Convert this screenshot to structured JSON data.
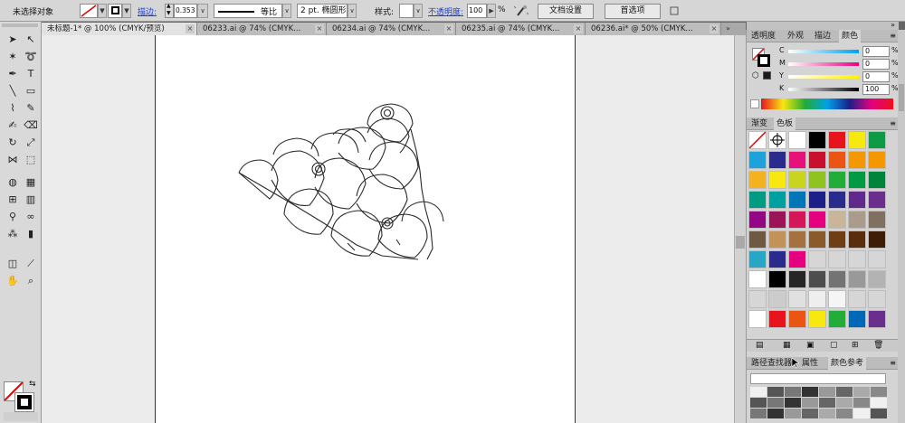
{
  "control_bar": {
    "selection_status": "未选择对象",
    "stroke_label": "描边:",
    "stroke_value": "0.353",
    "profile_label": "等比",
    "brush_label": "2 pt. 椭圆形",
    "style_label": "样式:",
    "opacity_label": "不透明度:",
    "opacity_value": "100",
    "opacity_unit": "%",
    "doc_setup_button": "文档设置",
    "preferences_button": "首选项"
  },
  "document_tabs": [
    {
      "label": "未标题-1* @ 100% (CMYK/预览)",
      "active": true
    },
    {
      "label": "06233.ai @ 74% (CMYK...",
      "active": false
    },
    {
      "label": "06234.ai @ 74% (CMYK...",
      "active": false
    },
    {
      "label": "06235.ai @ 74% (CMYK...",
      "active": false
    },
    {
      "label": "06236.ai* @ 50% (CMYK...",
      "active": false
    }
  ],
  "tab_close_glyph": "×",
  "color_panel": {
    "tabs": [
      "透明度",
      "外观",
      "描边",
      "颜色"
    ],
    "active_tab": "颜色",
    "channels": [
      {
        "label": "C",
        "value": "0"
      },
      {
        "label": "M",
        "value": "0"
      },
      {
        "label": "Y",
        "value": "0"
      },
      {
        "label": "K",
        "value": "100"
      }
    ],
    "unit": "%"
  },
  "swatches_panel": {
    "tabs": [
      "渐变",
      "色板"
    ],
    "active_tab": "色板",
    "rows": [
      [
        "#ffffff",
        "#ffffff",
        "#ffffff",
        "#000000",
        "#e8141c",
        "#f7e80f",
        "#0f9a45"
      ],
      [
        "#1ea2dc",
        "#2a2b8c",
        "#e5127b",
        "#c8102e",
        "#ea5514",
        "#f39800",
        "#f39800"
      ],
      [
        "#f5b21f",
        "#f7e80f",
        "#c9d41e",
        "#8fc31f",
        "#22ac38",
        "#009944",
        "#00843b"
      ],
      [
        "#009b80",
        "#00a0a0",
        "#0076b8",
        "#1d2088",
        "#2a2b8c",
        "#5f2a8c",
        "#6a2e8c"
      ],
      [
        "#920783",
        "#9c1458",
        "#d5165a",
        "#e4007f",
        "#c8b59a",
        "#a99c8a",
        "#7f7060"
      ],
      [
        "#6e5a43",
        "#c3925a",
        "#a5723f",
        "#8a5a2b",
        "#6e3f17",
        "#5a2d0c",
        "#3e1c05"
      ],
      [
        "#27a7c5",
        "#2a2b8c",
        "#e4007f",
        "#d6d6d6",
        "#d6d6d6",
        "#d6d6d6",
        "#d6d6d6"
      ],
      [
        "#ffffff",
        "#000000",
        "#262626",
        "#4d4d4d",
        "#737373",
        "#999999",
        "#b3b3b3"
      ],
      [
        "#d6d6d6",
        "#cccccc",
        "#e0e0e0",
        "#eeeeee",
        "#f5f5f5",
        "#d6d6d6",
        "#d6d6d6"
      ],
      [
        "#ffffff",
        "#e8141c",
        "#ea5514",
        "#f7e80f",
        "#22ac38",
        "#0068b7",
        "#6a2e8c"
      ]
    ]
  },
  "bottom_panel": {
    "tabs": [
      "路径查找器",
      "属性",
      "颜色参考"
    ]
  },
  "colors": {
    "accent_link": "#1a3fd1",
    "panel_bg": "#d4d4d4",
    "artboard": "#ffffff"
  },
  "tools": [
    "selection-tool-icon",
    "direct-selection-tool-icon",
    "magic-wand-tool-icon",
    "lasso-tool-icon",
    "pen-tool-icon",
    "type-tool-icon",
    "line-segment-tool-icon",
    "rectangle-tool-icon",
    "paintbrush-tool-icon",
    "pencil-tool-icon",
    "blob-brush-tool-icon",
    "eraser-tool-icon",
    "rotate-tool-icon",
    "scale-tool-icon",
    "width-tool-icon",
    "free-transform-tool-icon",
    "shape-builder-tool-icon",
    "perspective-grid-tool-icon",
    "mesh-tool-icon",
    "gradient-tool-icon",
    "eyedropper-tool-icon",
    "blend-tool-icon",
    "symbol-sprayer-tool-icon",
    "column-graph-tool-icon",
    "artboard-tool-icon",
    "slice-tool-icon",
    "hand-tool-icon",
    "zoom-tool-icon"
  ]
}
